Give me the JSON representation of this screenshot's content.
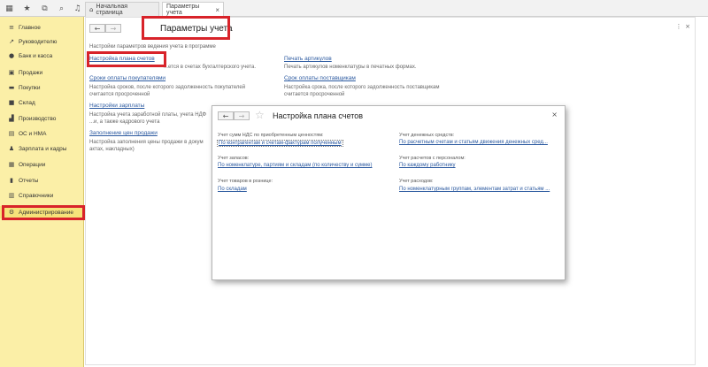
{
  "topbar": {
    "icons": [
      "grid-icon",
      "star-icon",
      "history-icon",
      "search-icon",
      "bell-icon"
    ],
    "tabs": [
      {
        "label": "Начальная страница",
        "icon": "home-icon"
      },
      {
        "label": "Параметры учета",
        "close": "×"
      }
    ]
  },
  "sidebar": {
    "items": [
      {
        "label": "Главное",
        "icon": "menu-icon"
      },
      {
        "label": "Руководителю",
        "icon": "chart-icon"
      },
      {
        "label": "Банк и касса",
        "icon": "ruble-icon"
      },
      {
        "label": "Продажи",
        "icon": "cart-icon"
      },
      {
        "label": "Покупки",
        "icon": "basket-icon"
      },
      {
        "label": "Склад",
        "icon": "box-icon"
      },
      {
        "label": "Производство",
        "icon": "factory-icon"
      },
      {
        "label": "ОС и НМА",
        "icon": "building-icon"
      },
      {
        "label": "Зарплата и кадры",
        "icon": "people-icon"
      },
      {
        "label": "Операции",
        "icon": "operations-icon"
      },
      {
        "label": "Отчеты",
        "icon": "report-icon"
      },
      {
        "label": "Справочники",
        "icon": "books-icon"
      },
      {
        "label": "Администрирование",
        "icon": "gear-icon"
      }
    ]
  },
  "main": {
    "title": "Параметры учета",
    "intro": "Настройки параметров ведения учета в программе",
    "left": [
      {
        "link": "Настройка плана счетов",
        "desc": "...ется в счетах бухгалтерского учета."
      },
      {
        "link": "Сроки оплаты покупателями",
        "desc": "Настройка сроков, после которого задолженность покупателей",
        "desc2": "считается просроченной"
      },
      {
        "link": "Настройки зарплаты",
        "desc": "Настройка учета заработной платы, учета НДФ",
        "desc2": "...и, а также кадрового учета"
      },
      {
        "link": "Заполнение цен продажи",
        "desc": "Настройка заполнения цены продажи в докум",
        "desc2": "актах, накладных)"
      }
    ],
    "right": [
      {
        "link": "Печать артикулов",
        "desc": "Печать артикулов номенклатуры в печатных формах."
      },
      {
        "link": "Срок оплаты поставщикам",
        "desc": "Настройка срока, после которого задолженность поставщикам",
        "desc2": "считается просроченной"
      }
    ]
  },
  "dialog": {
    "title": "Настройка плана счетов",
    "close": "×",
    "sections": [
      {
        "label": "Учет сумм НДС по приобретенным ценностям:",
        "value": "По контрагентам и счетам-фактурам полученным"
      },
      {
        "label": "Учет денежных средств:",
        "value": "По расчетным счетам и статьям движения денежных сред..."
      },
      {
        "label": "Учет запасов:",
        "value": "По номенклатуре, партиям и складам (по количеству и сумме)"
      },
      {
        "label": "Учет расчетов с персоналом:",
        "value": "По каждому работнику"
      },
      {
        "label": "Учет товаров в рознице:",
        "value": "По складам"
      },
      {
        "label": "Учет расходов:",
        "value": "По номенклатурным группам, элементам затрат и статьям ..."
      }
    ]
  },
  "nav": {
    "back": "←",
    "forward": "→"
  },
  "colors": {
    "sidebar_bg": "#fbefa7",
    "link": "#2c5aa0",
    "highlight": "#d8232a"
  }
}
